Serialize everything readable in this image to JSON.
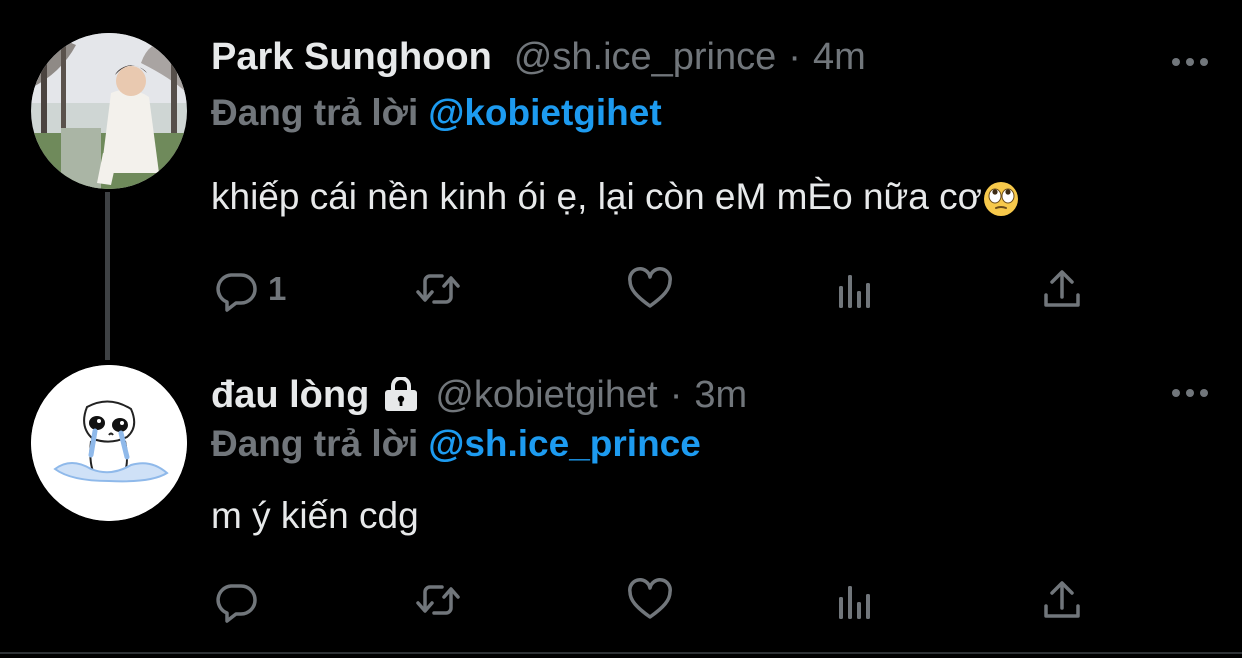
{
  "tweets": [
    {
      "display_name": "Park Sunghoon",
      "handle": "@sh.ice_prince",
      "separator": "·",
      "time": "4m",
      "reply_prefix": "Đang trả lời",
      "reply_to": "@kobietgihet",
      "text": "khiếp cái nền kinh ói ẹ, lại còn eM mÈo nữa cơ",
      "emoji": "face-with-rolling-eyes-icon",
      "reply_count": "1"
    },
    {
      "display_name": "đau lòng",
      "name_badge": "lock-icon",
      "handle": "@kobietgihet",
      "separator": "·",
      "time": "3m",
      "reply_prefix": "Đang trả lời",
      "reply_to": "@sh.ice_prince",
      "text": "m ý kiến cdg",
      "reply_count": ""
    }
  ],
  "actions": [
    "reply-icon",
    "retweet-icon",
    "like-icon",
    "analytics-icon",
    "share-icon"
  ],
  "colors": {
    "background": "#000000",
    "primary_text": "#e7e9ea",
    "secondary_text": "#71767b",
    "link": "#1d9bf0",
    "thread_line": "#3e4144"
  }
}
